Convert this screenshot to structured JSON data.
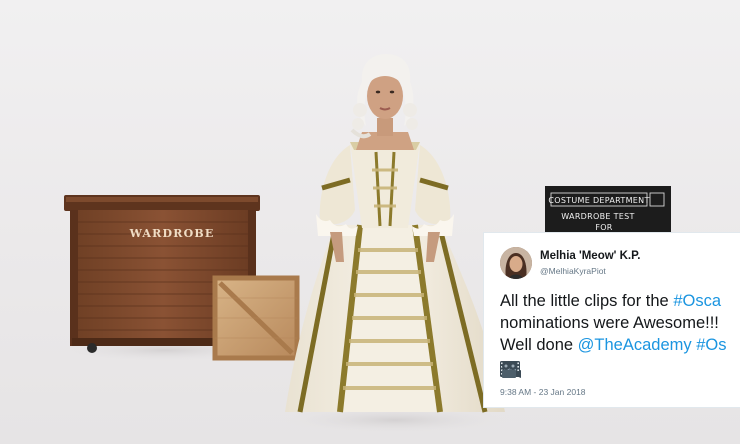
{
  "wardrobe_chest": {
    "label": "WARDROBE"
  },
  "slate": {
    "title": "COSTUME DEPARTMENT",
    "line1": "WARDROBE   TEST",
    "line2": "FOR"
  },
  "tweet": {
    "author_name": "Melhia 'Meow' K.P.",
    "author_handle": "@MelhiaKyraPiot",
    "line1_text": "All the little clips for the ",
    "line1_hashtag": "#Osca",
    "line2_text": "nominations were Awesome!!!",
    "line3_text": "Well done ",
    "line3_mention": "@TheAcademy",
    "line3_space": " ",
    "line3_hashtag": "#Os",
    "emojis": [
      "film-frames-icon",
      "movie-camera-icon"
    ],
    "timestamp": "9:38 AM - 23 Jan 2018",
    "colors": {
      "link": "#1b95e0",
      "text": "#14171a",
      "muted": "#657786"
    }
  }
}
